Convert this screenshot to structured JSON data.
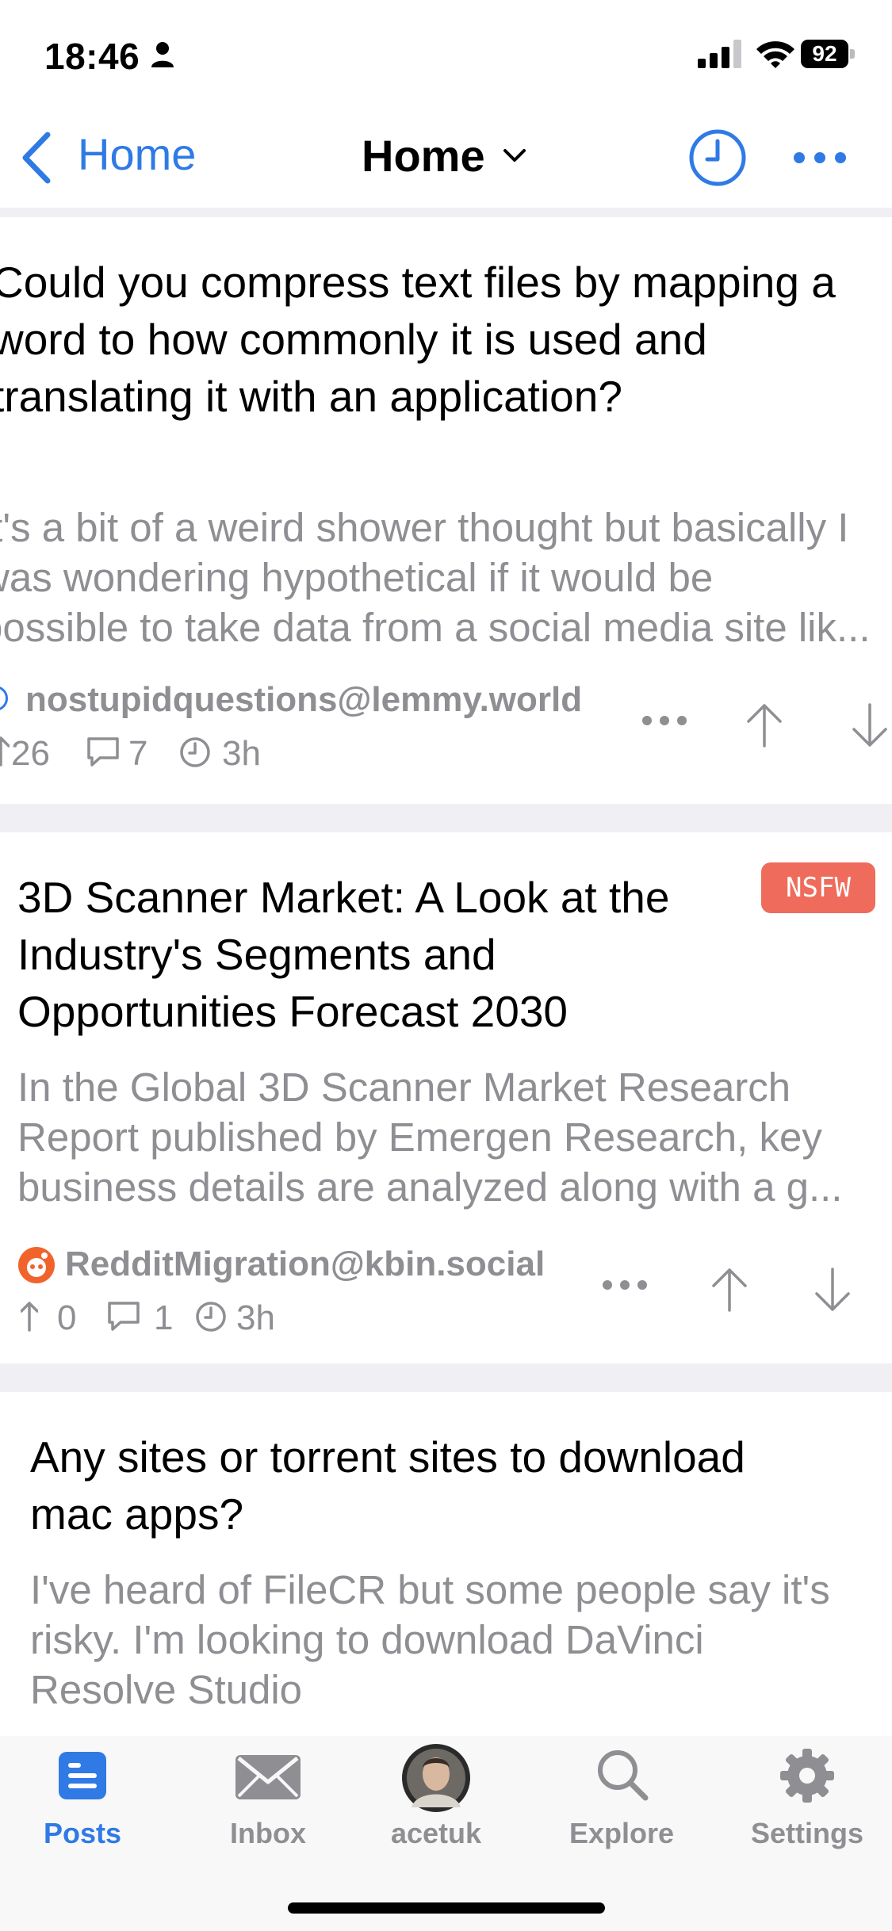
{
  "status_bar": {
    "time": "18:46",
    "battery": "92"
  },
  "nav": {
    "back_label": "Home",
    "title": "Home"
  },
  "posts": [
    {
      "title_lines": [
        "Could you compress text files by mapping a",
        "word to how commonly it is used and",
        "translating it with an application?"
      ],
      "body_lines": [
        "It's a bit of a weird shower thought but basically I",
        "was wondering hypothetical if it would be",
        "possible to take data from a social media site lik..."
      ],
      "community": "nostupidquestions@lemmy.world",
      "score": "26",
      "comments": "7",
      "age": "3h"
    },
    {
      "title_lines": [
        "3D Scanner Market: A Look at the",
        "Industry's Segments and",
        "Opportunities Forecast 2030"
      ],
      "badge": "NSFW",
      "body_lines": [
        "In the Global 3D Scanner Market Research",
        "Report published by Emergen Research, key",
        "business details are analyzed along with a g..."
      ],
      "community": "RedditMigration@kbin.social",
      "score": "0",
      "comments": "1",
      "age": "3h"
    },
    {
      "title_lines": [
        "Any sites or torrent sites to download",
        "mac apps?"
      ],
      "body_lines": [
        "I've heard of FileCR but some people say it's",
        "risky. I'm looking to download DaVinci",
        "Resolve Studio"
      ]
    }
  ],
  "tabs": [
    {
      "label": "Posts",
      "icon": "posts-icon",
      "active": true
    },
    {
      "label": "Inbox",
      "icon": "envelope-icon",
      "active": false
    },
    {
      "label": "acetuk",
      "icon": "avatar",
      "active": false
    },
    {
      "label": "Explore",
      "icon": "magnifier-icon",
      "active": false
    },
    {
      "label": "Settings",
      "icon": "gear-icon",
      "active": false
    }
  ],
  "colors": {
    "accent": "#2f7ae5",
    "secondary_text": "#8e8e93",
    "nsfw_badge": "#ef6b5b",
    "separator": "#efeff4"
  }
}
